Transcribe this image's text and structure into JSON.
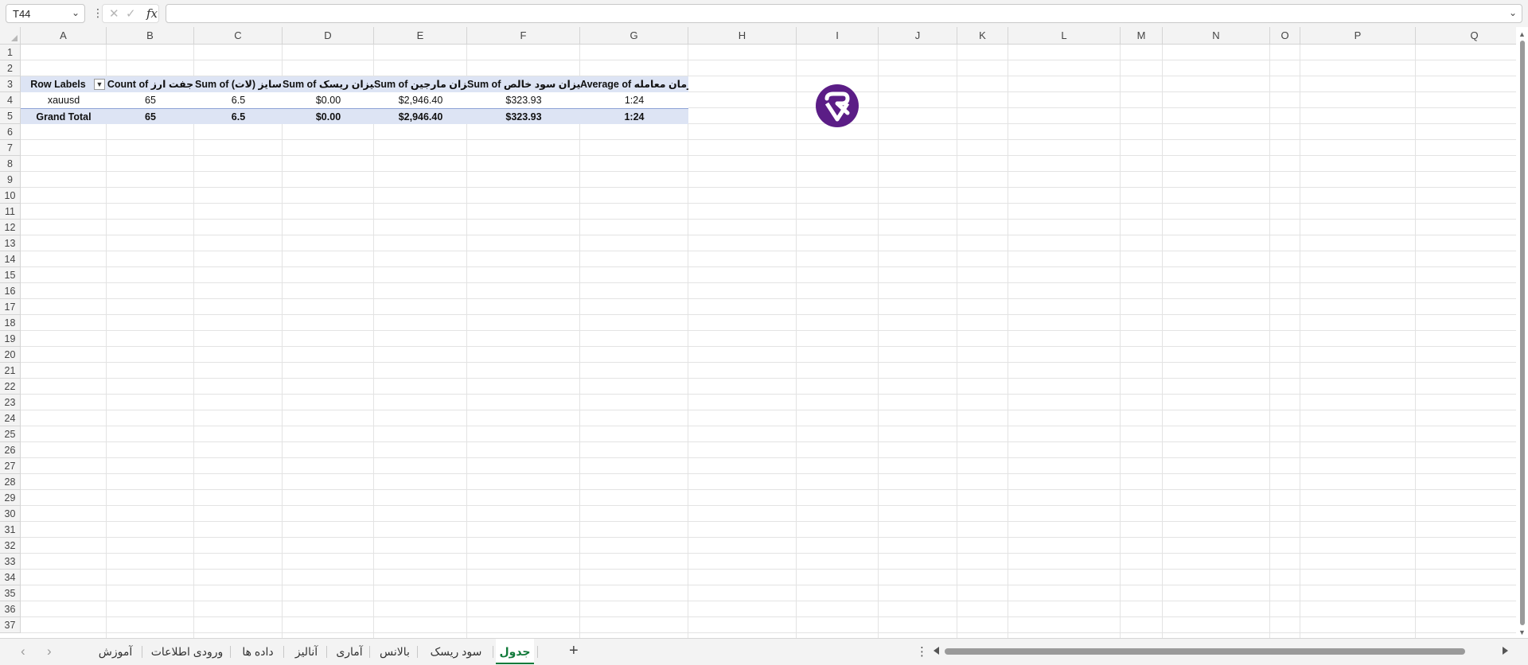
{
  "formula_bar": {
    "name_box": "T44",
    "formula": "",
    "fx_label": "fx",
    "cancel_glyph": "✕",
    "enter_glyph": "✓"
  },
  "columns": [
    "A",
    "B",
    "C",
    "D",
    "E",
    "F",
    "G",
    "H",
    "I",
    "J",
    "K",
    "L",
    "M",
    "N",
    "O",
    "P",
    "Q"
  ],
  "rows": [
    "1",
    "2",
    "3",
    "4",
    "5",
    "6",
    "7",
    "8",
    "9",
    "10",
    "11",
    "12",
    "13",
    "14",
    "15",
    "16",
    "17",
    "18",
    "19",
    "20",
    "21",
    "22",
    "23",
    "24",
    "25",
    "26",
    "27",
    "28",
    "29",
    "30",
    "31",
    "32",
    "33",
    "34",
    "35",
    "36",
    "37"
  ],
  "pivot": {
    "headers": [
      "Row Labels",
      "Count of جفت ارز",
      "Sum of سایز (لات)",
      "Sum of میزان ریسک",
      "Sum of میزان مارجین",
      "Sum of میزان سود خالص",
      "Average of زمان معامله"
    ],
    "row": [
      "xauusd",
      "65",
      "6.5",
      "$0.00",
      "$2,946.40",
      "$323.93",
      "1:24"
    ],
    "total": [
      "Grand Total",
      "65",
      "6.5",
      "$0.00",
      "$2,946.40",
      "$323.93",
      "1:24"
    ],
    "filter_glyph": "▼"
  },
  "logo": {
    "icon": "rs-logo-icon",
    "color": "#5b1d86"
  },
  "sheet_tabs": {
    "tabs": [
      "آموزش",
      "ورودی اطلاعات",
      "داده ها",
      "آنالیز",
      "آماری",
      "بالانس",
      "سود ریسک",
      "جدول"
    ],
    "active": "جدول",
    "add_label": "+",
    "prev_glyph": "‹",
    "next_glyph": "›",
    "more_glyph": "⋮"
  },
  "colors": {
    "pivot_header": "#dde4f4",
    "active_tab_accent": "#117a3a",
    "logo": "#5b1d86"
  }
}
